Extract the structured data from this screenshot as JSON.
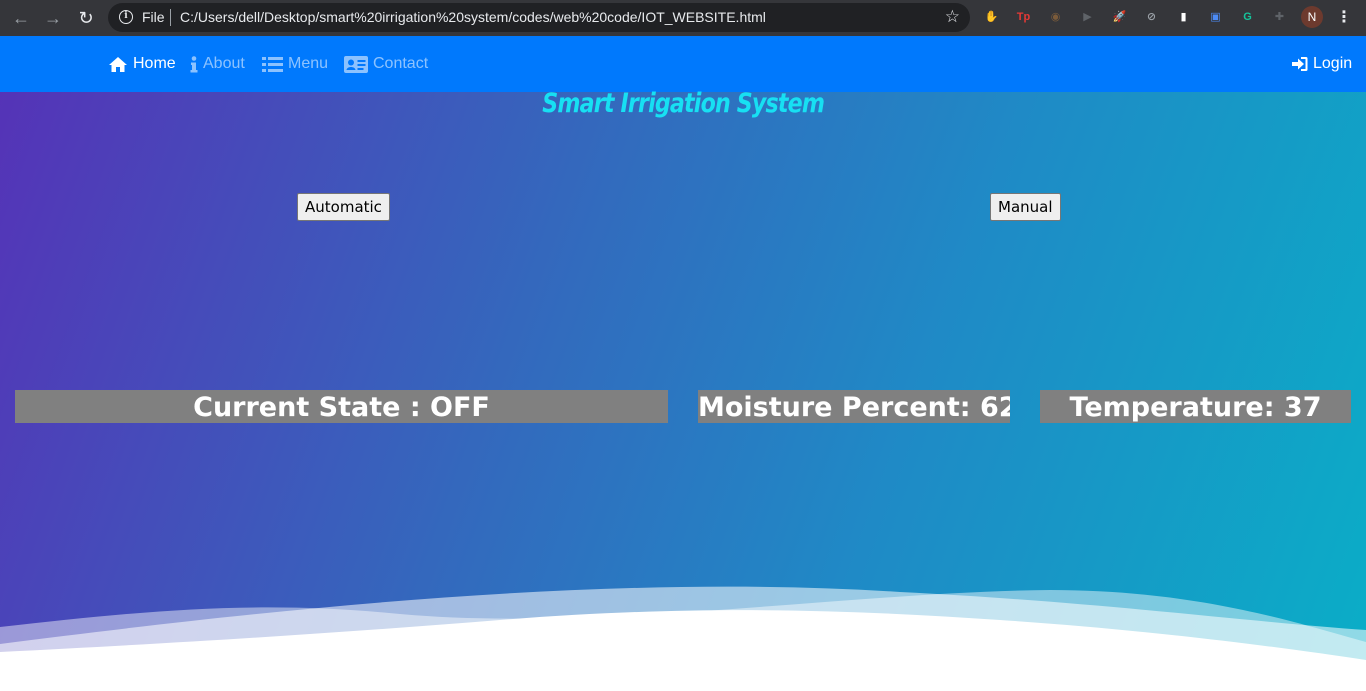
{
  "browser": {
    "scheme_label": "File",
    "url": "C:/Users/dell/Desktop/smart%20irrigation%20system/codes/web%20code/IOT_WEBSITE.html",
    "profile_initial": "N",
    "extensions": [
      {
        "name": "stop-extension-icon",
        "glyph": "✋",
        "color": "#d93025"
      },
      {
        "name": "tp-extension-icon",
        "glyph": "Tp",
        "color": "#e53935"
      },
      {
        "name": "owl-extension-icon",
        "glyph": "◉",
        "color": "#7b5b3a"
      },
      {
        "name": "video-extension-icon",
        "glyph": "▶",
        "color": "#5f6368"
      },
      {
        "name": "rocket-extension-icon",
        "glyph": "🚀",
        "color": "#5f6368"
      },
      {
        "name": "block-extension-icon",
        "glyph": "⊘",
        "color": "#9aa0a6"
      },
      {
        "name": "chart-extension-icon",
        "glyph": "▮",
        "color": "#ffffff"
      },
      {
        "name": "screen-extension-icon",
        "glyph": "▣",
        "color": "#4c8bf5"
      },
      {
        "name": "grammarly-extension-icon",
        "glyph": "G",
        "color": "#15c39a"
      },
      {
        "name": "puzzle-extension-icon",
        "glyph": "✚",
        "color": "#5f6368"
      }
    ]
  },
  "navbar": {
    "items": [
      {
        "label": "Home",
        "icon": "home-icon",
        "active": true
      },
      {
        "label": "About",
        "icon": "info-icon",
        "active": false
      },
      {
        "label": "Menu",
        "icon": "list-icon",
        "active": false
      },
      {
        "label": "Contact",
        "icon": "contact-card-icon",
        "active": false
      }
    ],
    "login_label": "Login"
  },
  "site": {
    "title": "Smart Irrigation System"
  },
  "controls": {
    "automatic_label": "Automatic",
    "manual_label": "Manual"
  },
  "status": {
    "current_state": "Current State : OFF",
    "moisture": "Moisture Percent: 62",
    "temperature": "Temperature: 37"
  },
  "colors": {
    "navbar": "#0079fd",
    "title": "#17e0f3",
    "stat_box": "#808080"
  }
}
